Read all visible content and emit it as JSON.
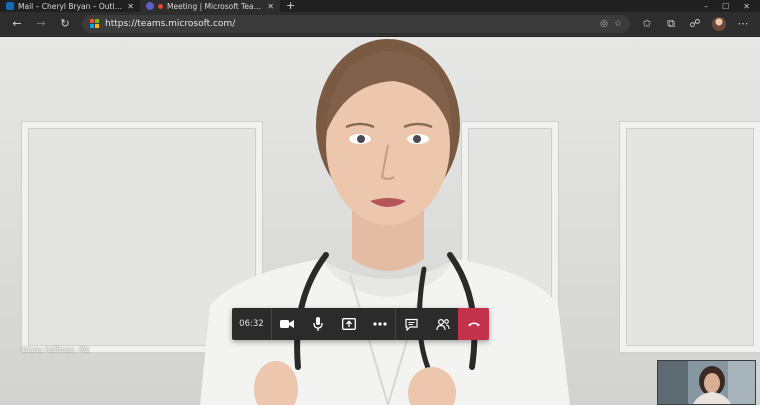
{
  "browser": {
    "tabs": [
      {
        "title": "Mail – Cheryl Bryan – Outlook",
        "favicon": "outlook-icon",
        "active": false
      },
      {
        "title": "Meeting | Microsoft Teams",
        "favicon": "teams-icon",
        "recording": true,
        "active": true
      }
    ],
    "new_tab_glyph": "+",
    "window_controls": [
      "–",
      "☐",
      "✕"
    ],
    "address": {
      "url": "https://teams.microsoft.com/"
    },
    "toolbar_glyphs": {
      "back": "←",
      "forward": "→",
      "refresh": "↻",
      "tracking": "◎",
      "favorite": "☆",
      "favorites": "✩",
      "collections": "⧉",
      "feedback": "☍",
      "more": "⋯"
    }
  },
  "meeting": {
    "participant_name": "Diana Hoffman, RN",
    "duration": "06:32",
    "controls": {
      "camera": "camera-icon",
      "microphone": "microphone-icon",
      "share": "share-screen-icon",
      "more": "more-actions-icon",
      "chat": "chat-icon",
      "participants": "participants-icon",
      "hangup": "hang-up-icon"
    },
    "colors": {
      "control_bar": "#2b2b2b",
      "hangup": "#c4314b",
      "teams_brand": "#5b5fc7",
      "outlook_brand": "#0f6cbd"
    }
  }
}
